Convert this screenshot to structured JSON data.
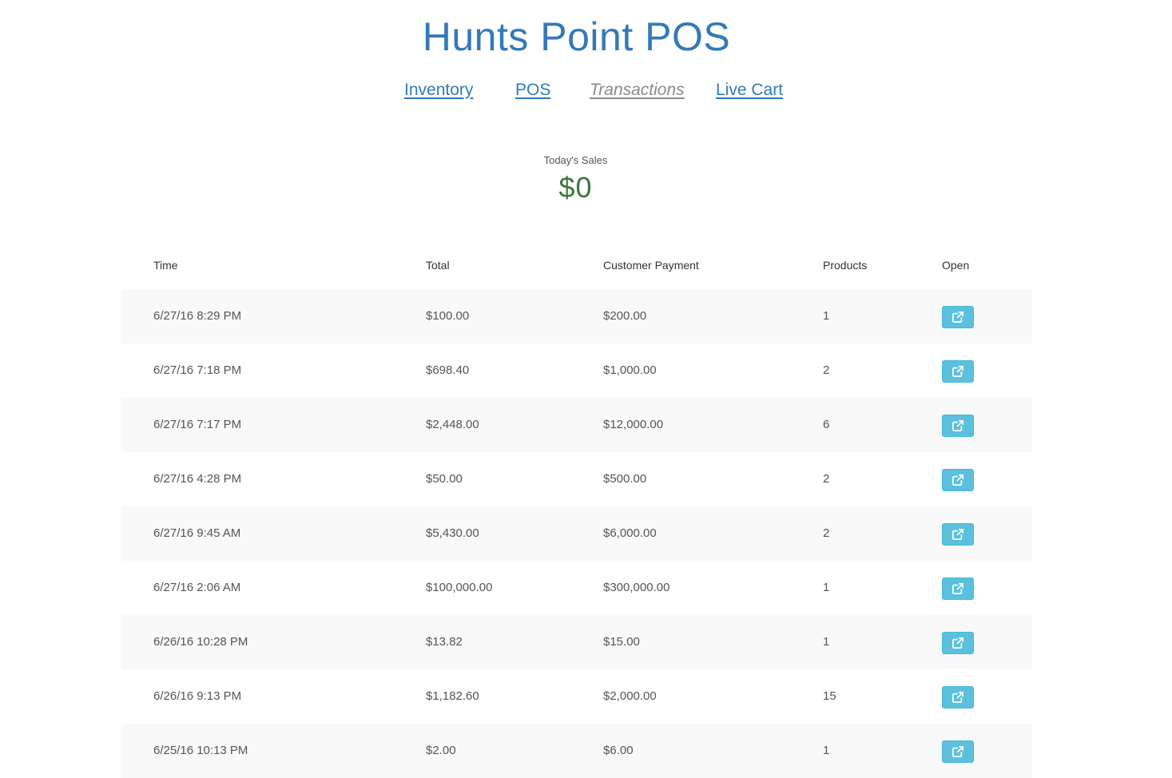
{
  "app": {
    "title": "Hunts Point POS"
  },
  "nav": {
    "items": [
      {
        "label": "Inventory",
        "active": false
      },
      {
        "label": "POS",
        "active": false
      },
      {
        "label": "Transactions",
        "active": true
      },
      {
        "label": "Live Cart",
        "active": false
      }
    ]
  },
  "sales": {
    "label": "Today's Sales",
    "value": "$0"
  },
  "table": {
    "headers": {
      "time": "Time",
      "total": "Total",
      "payment": "Customer Payment",
      "products": "Products",
      "open": "Open"
    },
    "rows": [
      {
        "time": "6/27/16 8:29 PM",
        "total": "$100.00",
        "payment": "$200.00",
        "products": "1"
      },
      {
        "time": "6/27/16 7:18 PM",
        "total": "$698.40",
        "payment": "$1,000.00",
        "products": "2"
      },
      {
        "time": "6/27/16 7:17 PM",
        "total": "$2,448.00",
        "payment": "$12,000.00",
        "products": "6"
      },
      {
        "time": "6/27/16 4:28 PM",
        "total": "$50.00",
        "payment": "$500.00",
        "products": "2"
      },
      {
        "time": "6/27/16 9:45 AM",
        "total": "$5,430.00",
        "payment": "$6,000.00",
        "products": "2"
      },
      {
        "time": "6/27/16 2:06 AM",
        "total": "$100,000.00",
        "payment": "$300,000.00",
        "products": "1"
      },
      {
        "time": "6/26/16 10:28 PM",
        "total": "$13.82",
        "payment": "$15.00",
        "products": "1"
      },
      {
        "time": "6/26/16 9:13 PM",
        "total": "$1,182.60",
        "payment": "$2,000.00",
        "products": "15"
      },
      {
        "time": "6/25/16 10:13 PM",
        "total": "$2.00",
        "payment": "$6.00",
        "products": "1"
      }
    ],
    "open_icon": "external-link-icon"
  },
  "colors": {
    "brand": "#337ab7",
    "sales": "#3c763d",
    "button": "#5bc0de"
  }
}
